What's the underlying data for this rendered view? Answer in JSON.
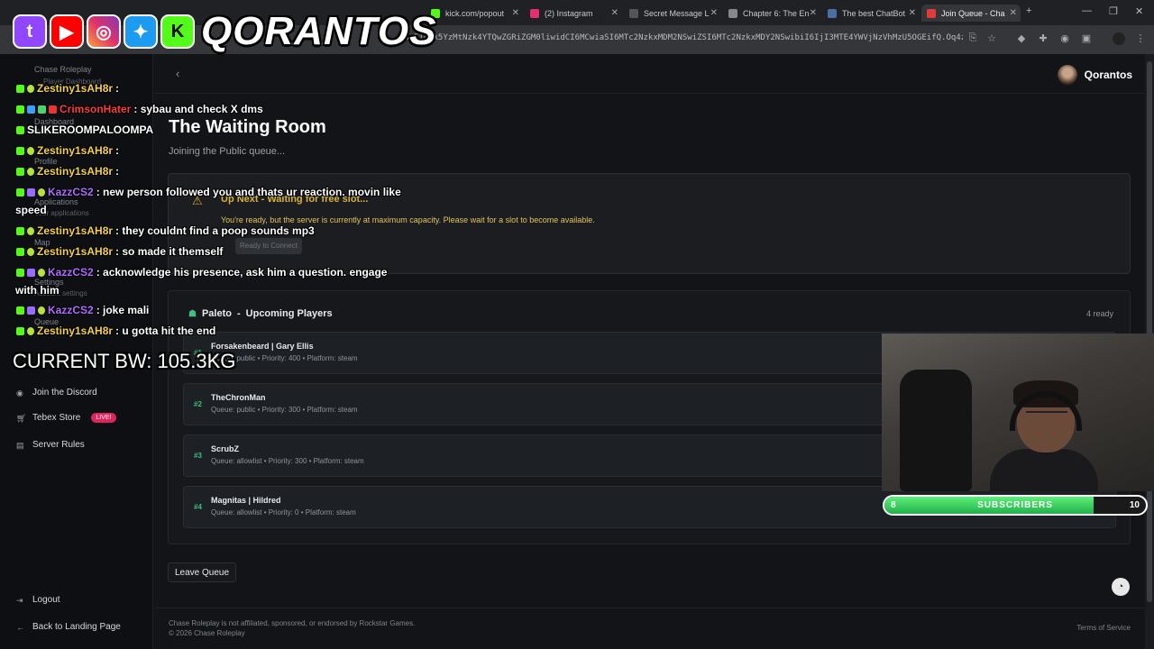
{
  "browser": {
    "tabs": [
      {
        "label": "kick.com/popout",
        "color": "#53fc18"
      },
      {
        "label": "(2) Instagram",
        "color": "#e1306c"
      },
      {
        "label": "Secret Message L",
        "color": "#444444"
      },
      {
        "label": "Chapter 6: The En",
        "color": "#888888"
      },
      {
        "label": "The best ChatBot",
        "color": "#4a6fa5"
      },
      {
        "label": "Join Queue - Cha",
        "color": "#e33b3b"
      }
    ],
    "url": "NzI1LTk5YzMtNzk4YTQwZGRiZGM0liwidCI6MCwiaSI6MTc2NzkxMDM2NSwiZSI6MTc2NzkxMDY2NSwibiI6IjI3MTE4YWVjNzVhMzU5OGEifQ.Oq4z5kYn...",
    "new_tab": "+"
  },
  "overlay": {
    "brand_name": "QORANTOS",
    "bandwidth": "CURRENT BW: 105.3KG",
    "chat": [
      {
        "user": "Zestiny1sAH8r",
        "color": "#f5d142",
        "msg": ":"
      },
      {
        "user": "CrimsonHater",
        "color": "#ff3b3b",
        "msg": ": sybau and check X dms"
      },
      {
        "user": "SLIKEROOMPALOOMPA",
        "color": "#ffffff",
        "msg": ""
      },
      {
        "user": "Zestiny1sAH8r",
        "color": "#f5d142",
        "msg": ":"
      },
      {
        "user": "Zestiny1sAH8r",
        "color": "#f5d142",
        "msg": ":"
      },
      {
        "user": "KazzCS2",
        "color": "#b06bff",
        "msg": ": new person followed you and thats ur reaction. movin like"
      },
      {
        "user": "",
        "color": "#ffffff",
        "msg": "speed"
      },
      {
        "user": "Zestiny1sAH8r",
        "color": "#f5d142",
        "msg": ": they couldnt find a poop sounds mp3"
      },
      {
        "user": "Zestiny1sAH8r",
        "color": "#f5d142",
        "msg": ": so made it themself"
      },
      {
        "user": "KazzCS2",
        "color": "#b06bff",
        "msg": ": acknowledge his presence, ask him a question. engage"
      },
      {
        "user": "",
        "color": "#ffffff",
        "msg": "with him"
      },
      {
        "user": "KazzCS2",
        "color": "#b06bff",
        "msg": ": joke mali"
      },
      {
        "user": "Zestiny1sAH8r",
        "color": "#f5d142",
        "msg": ": u gotta hit the end"
      }
    ],
    "subs": {
      "current": "8",
      "label": "SUBSCRIBERS",
      "goal": "10",
      "fraction": 0.8
    }
  },
  "sidebar": {
    "ghost": [
      "Chase Roleplay",
      "Player Dashboard",
      "Dashboard",
      "Your overview",
      "Profile",
      "Applications",
      "Your applications",
      "Map",
      "Settings",
      "Account settings",
      "Queue"
    ],
    "items": [
      {
        "label": "Join the Discord",
        "icon": "discord-icon"
      },
      {
        "label": "Tebex Store",
        "icon": "cart-icon",
        "badge": "LIVE!"
      },
      {
        "label": "Server Rules",
        "icon": "book-icon"
      }
    ],
    "logout": "Logout",
    "back": "Back to Landing Page"
  },
  "header": {
    "username": "Qorantos"
  },
  "main": {
    "title": "The Waiting Room",
    "subtitle": "Joining the Public queue...",
    "alert": {
      "title": "Up Next - Waiting for free slot...",
      "text": "You're ready, but the server is currently at maximum capacity. Please wait for a slot to become available.",
      "button": "Ready to Connect"
    },
    "queue": {
      "server": "Paleto",
      "separator": "-",
      "heading": "Upcoming Players",
      "ready_count": "4 ready",
      "players": [
        {
          "rank": "#1",
          "name": "Forsakenbeard | Gary Ellis",
          "meta": "Queue: public • Priority: 400 • Platform: steam"
        },
        {
          "rank": "#2",
          "name": "TheChronMan",
          "meta": "Queue: public • Priority: 300 • Platform: steam"
        },
        {
          "rank": "#3",
          "name": "ScrubZ",
          "meta": "Queue: allowlist • Priority: 300 • Platform: steam"
        },
        {
          "rank": "#4",
          "name": "Magnitas | Hildred",
          "meta": "Queue: allowlist • Priority: 0 • Platform: steam"
        }
      ]
    },
    "leave_button": "Leave Queue"
  },
  "footer": {
    "line1": "Chase Roleplay is not affiliated, sponsored, or endorsed by Rockstar Games.",
    "line2": "© 2026 Chase Roleplay",
    "terms": "Terms of Service"
  }
}
